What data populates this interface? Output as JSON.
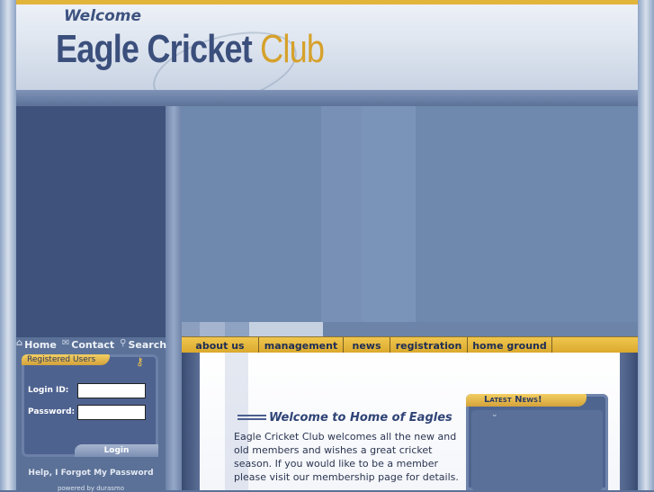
{
  "header": {
    "welcome": "Welcome",
    "club_name_main": "Eagle Cricket",
    "club_name_accent": "Club"
  },
  "quicklinks": [
    {
      "icon": "home-icon",
      "label": "Home"
    },
    {
      "icon": "mail-icon",
      "label": "Contact"
    },
    {
      "icon": "search-icon",
      "label": "Search"
    }
  ],
  "nav": [
    {
      "label": "about us"
    },
    {
      "label": "management"
    },
    {
      "label": "news"
    },
    {
      "label": "registration"
    },
    {
      "label": "home ground"
    }
  ],
  "login": {
    "tab_title": "Registered Users",
    "icon": "key-icon",
    "login_id_label": "Login ID:",
    "login_id_value": "",
    "password_label": "Password:",
    "password_value": "",
    "button": "Login",
    "forgot": "Help, I Forgot My Password",
    "powered": "powered by durasmo"
  },
  "content": {
    "heading": "Welcome to Home of Eagles",
    "text": "Eagle Cricket Club welcomes all the new and old members and wishes a great cricket season. If you would like to be a member please visit our membership page for details."
  },
  "news": {
    "title": "Latest News!"
  },
  "colors": {
    "accent_gold": "#e2b43a",
    "navy": "#3b4f7c"
  }
}
